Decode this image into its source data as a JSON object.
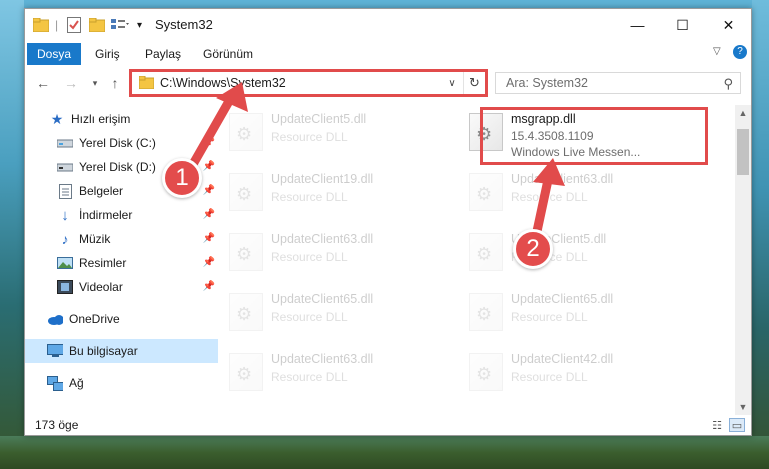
{
  "window": {
    "title": "System32",
    "controls": {
      "minimize": "—",
      "maximize": "☐",
      "close": "✕"
    }
  },
  "ribbon": {
    "tabs": [
      {
        "label": "Dosya",
        "active": true
      },
      {
        "label": "Giriş"
      },
      {
        "label": "Paylaş"
      },
      {
        "label": "Görünüm"
      }
    ]
  },
  "address": {
    "path": "C:\\Windows\\System32",
    "search_placeholder": "Ara: System32"
  },
  "sidebar": {
    "items": [
      {
        "label": "Hızlı erişim",
        "icon": "star-icon",
        "pinned": false
      },
      {
        "label": "Yerel Disk (C:)",
        "icon": "drive-icon",
        "pinned": true
      },
      {
        "label": "Yerel Disk (D:)",
        "icon": "drive-icon",
        "pinned": true
      },
      {
        "label": "Belgeler",
        "icon": "document-icon",
        "pinned": true
      },
      {
        "label": "İndirmeler",
        "icon": "download-icon",
        "pinned": true
      },
      {
        "label": "Müzik",
        "icon": "music-icon",
        "pinned": true
      },
      {
        "label": "Resimler",
        "icon": "picture-icon",
        "pinned": true
      },
      {
        "label": "Videolar",
        "icon": "video-icon",
        "pinned": true
      },
      {
        "label": "OneDrive",
        "icon": "cloud-icon"
      },
      {
        "label": "Bu bilgisayar",
        "icon": "computer-icon",
        "selected": true
      },
      {
        "label": "Ağ",
        "icon": "network-icon"
      }
    ]
  },
  "files": {
    "highlighted": {
      "name": "msgrapp.dll",
      "version": "15.4.3508.1109",
      "description": "Windows Live Messen..."
    },
    "faded": [
      {
        "name": "UpdateClient5.dll",
        "type": "Resource DLL"
      },
      {
        "name": "UpdateClient19.dll",
        "type": "Resource DLL"
      },
      {
        "name": "UpdateClient63.dll",
        "type": "Resource DLL"
      },
      {
        "name": "UpdateClient63.dll",
        "type": "Resource DLL"
      },
      {
        "name": "UpdateClient5.dll",
        "type": "Resource DLL"
      },
      {
        "name": "UpdateClient65.dll",
        "type": "Resource DLL"
      },
      {
        "name": "UpdateClient65.dll",
        "type": "Resource DLL"
      },
      {
        "name": "UpdateClient63.dll",
        "type": "Resource DLL"
      },
      {
        "name": "UpdateClient42.dll",
        "type": "Resource DLL"
      }
    ]
  },
  "status": {
    "count": "173 öge"
  },
  "annotations": {
    "step1": "1",
    "step2": "2",
    "color": "#e14b4b"
  }
}
